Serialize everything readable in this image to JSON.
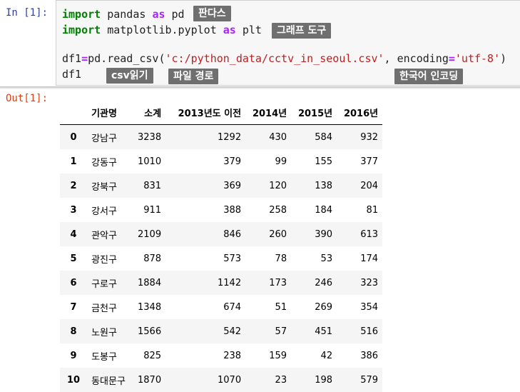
{
  "input_prompt": "In [1]:",
  "output_prompt": "Out[1]:",
  "code": {
    "line1": {
      "kw1": "import",
      "mod": " pandas ",
      "kw2": "as",
      "alias": " pd"
    },
    "line2": {
      "kw1": "import",
      "mod": " matplotlib.pyplot ",
      "kw2": "as",
      "alias": " plt"
    },
    "line4": {
      "var": "df1",
      "op1": "=",
      "call": "pd.read_csv(",
      "path": "'c:/python_data/cctv_in_seoul.csv'",
      "mid": ", encoding",
      "op2": "=",
      "enc": "'utf-8'",
      "end": ")"
    },
    "line5": "df1"
  },
  "annotations": {
    "pandas": "판다스",
    "graph_tool": "그래프 도구",
    "csv_read": "csv읽기",
    "file_path": "파일 경로",
    "korean_encoding": "한국어 인코딩"
  },
  "table": {
    "columns": [
      "",
      "기관명",
      "소계",
      "2013년도 이전",
      "2014년",
      "2015년",
      "2016년"
    ],
    "rows": [
      [
        "0",
        "강남구",
        "3238",
        "1292",
        "430",
        "584",
        "932"
      ],
      [
        "1",
        "강동구",
        "1010",
        "379",
        "99",
        "155",
        "377"
      ],
      [
        "2",
        "강북구",
        "831",
        "369",
        "120",
        "138",
        "204"
      ],
      [
        "3",
        "강서구",
        "911",
        "388",
        "258",
        "184",
        "81"
      ],
      [
        "4",
        "관악구",
        "2109",
        "846",
        "260",
        "390",
        "613"
      ],
      [
        "5",
        "광진구",
        "878",
        "573",
        "78",
        "53",
        "174"
      ],
      [
        "6",
        "구로구",
        "1884",
        "1142",
        "173",
        "246",
        "323"
      ],
      [
        "7",
        "금천구",
        "1348",
        "674",
        "51",
        "269",
        "354"
      ],
      [
        "8",
        "노원구",
        "1566",
        "542",
        "57",
        "451",
        "516"
      ],
      [
        "9",
        "도봉구",
        "825",
        "238",
        "159",
        "42",
        "386"
      ],
      [
        "10",
        "동대문구",
        "1870",
        "1070",
        "23",
        "198",
        "579"
      ]
    ]
  }
}
